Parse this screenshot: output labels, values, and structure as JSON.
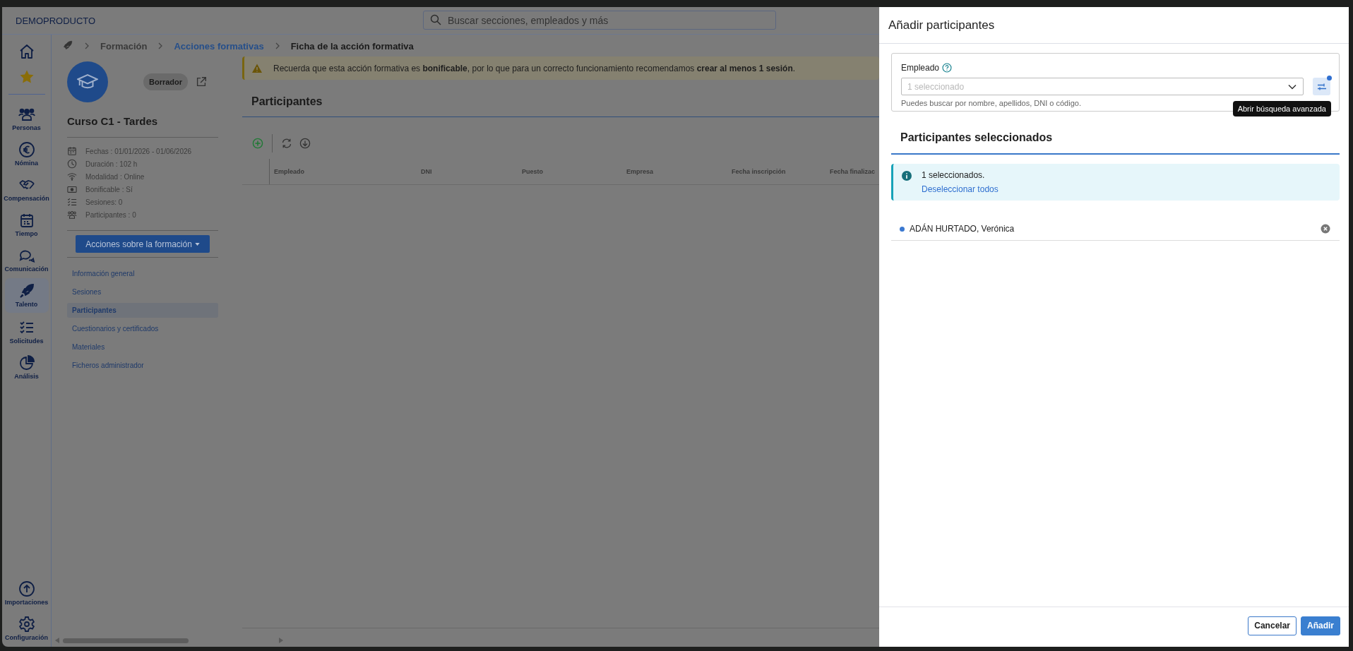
{
  "app": {
    "brand": "DEMOPRODUCTO",
    "search_placeholder": "Buscar secciones, empleados y más"
  },
  "nav": {
    "items": [
      {
        "label": "Personas",
        "selected": false
      },
      {
        "label": "Nómina",
        "selected": false
      },
      {
        "label": "Compensación",
        "selected": false
      },
      {
        "label": "Tiempo",
        "selected": false
      },
      {
        "label": "Comunicación",
        "selected": false
      },
      {
        "label": "Talento",
        "selected": true
      },
      {
        "label": "Solicitudes",
        "selected": false
      },
      {
        "label": "Análisis",
        "selected": false
      }
    ],
    "bottom": [
      {
        "label": "Importaciones",
        "selected": false
      },
      {
        "label": "Configuración",
        "selected": false
      }
    ]
  },
  "breadcrumb": [
    {
      "label": "Formación",
      "kind": "text"
    },
    {
      "label": "Acciones formativas",
      "kind": "link"
    },
    {
      "label": "Ficha de la acción formativa",
      "kind": "current"
    }
  ],
  "course": {
    "status": "Borrador",
    "title": "Curso C1 - Tardes",
    "facts": [
      "Fechas : 01/01/2026 - 01/06/2026",
      "Duración : 102 h",
      "Modalidad : Online",
      "Bonificable : Sí",
      "Sesiones: 0",
      "Participantes : 0"
    ],
    "actions_button": "Acciones sobre la formación",
    "menu": [
      {
        "label": "Información general",
        "selected": false
      },
      {
        "label": "Sesiones",
        "selected": false
      },
      {
        "label": "Participantes",
        "selected": true
      },
      {
        "label": "Cuestionarios y certificados",
        "selected": false
      },
      {
        "label": "Materiales",
        "selected": false
      },
      {
        "label": "Ficheros administrador",
        "selected": false
      }
    ]
  },
  "alert": {
    "text": "Recuerda que esta acción formativa es **bonificable**, por lo que para un correcto funcionamiento recomendamos **crear al menos 1 sesión**."
  },
  "participants": {
    "title": "Participantes",
    "columns": [
      "Empleado",
      "DNI",
      "Puesto",
      "Empresa",
      "Fecha inscripción",
      "Fecha finalizac"
    ]
  },
  "drawer": {
    "title": "Añadir participantes",
    "field": {
      "label": "Empleado",
      "placeholder": "1 seleccionado",
      "hint": "Puedes buscar por nombre, apellidos, DNI o código."
    },
    "filter_active": true,
    "tooltip": "Abrir búsqueda avanzada",
    "selected_title": "Participantes seleccionados",
    "info": {
      "text": "1 seleccionados.",
      "link": "Deseleccionar todos"
    },
    "people": [
      {
        "name": "ADÁN HURTADO, Verónica"
      }
    ],
    "buttons": [
      {
        "label": "Cancelar",
        "kind": "secondary"
      },
      {
        "label": "Añadir",
        "kind": "primary"
      }
    ]
  }
}
